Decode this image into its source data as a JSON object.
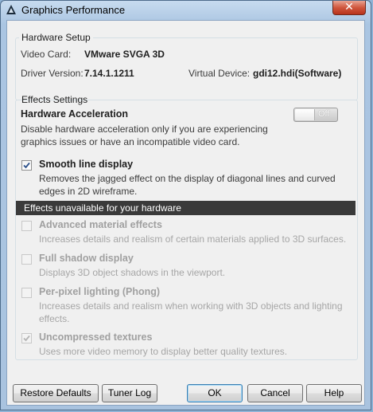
{
  "window": {
    "title": "Graphics Performance",
    "close_symbol": "✕"
  },
  "hardware_setup": {
    "legend": "Hardware Setup",
    "video_card_label": "Video Card:",
    "video_card_value": "VMware SVGA 3D",
    "driver_version_label": "Driver Version:",
    "driver_version_value": "7.14.1.1211",
    "virtual_device_label": "Virtual Device:",
    "virtual_device_value": "gdi12.hdi(Software)"
  },
  "effects_settings": {
    "legend": "Effects Settings",
    "hardware_acceleration": {
      "title": "Hardware Acceleration",
      "toggle_state": "Off",
      "description": "Disable hardware acceleration only if you are experiencing graphics issues or have an incompatible video card."
    },
    "smooth_line": {
      "title": "Smooth line display",
      "checked": true,
      "description": "Removes the jagged effect on the display of diagonal lines and curved edges in 2D wireframe."
    },
    "unavailable_header": "Effects unavailable for your hardware",
    "advanced_material": {
      "title": "Advanced material effects",
      "checked": false,
      "description": "Increases details and realism of certain materials applied to 3D surfaces."
    },
    "full_shadow": {
      "title": "Full shadow display",
      "checked": false,
      "description": "Displays 3D object shadows in the viewport."
    },
    "per_pixel": {
      "title": "Per-pixel lighting (Phong)",
      "checked": false,
      "description": "Increases details and realism when working with 3D objects and lighting effects."
    },
    "uncompressed": {
      "title": "Uncompressed textures",
      "checked": true,
      "description": "Uses more video memory to display better quality textures."
    }
  },
  "buttons": {
    "restore_defaults": "Restore Defaults",
    "tuner_log": "Tuner Log",
    "ok": "OK",
    "cancel": "Cancel",
    "help": "Help"
  },
  "colors": {
    "unavailable_bar": "#3a3a3a",
    "disabled_text": "#a0a0a0",
    "titlebar_close": "#c84a33"
  }
}
